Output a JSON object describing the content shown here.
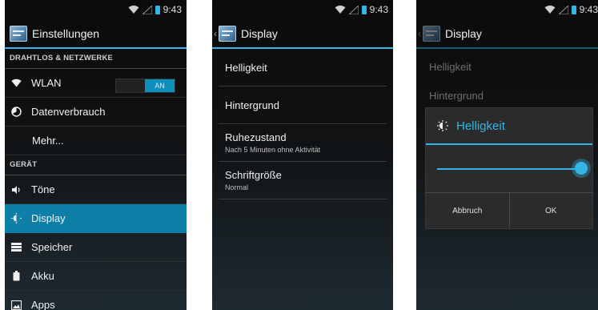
{
  "status": {
    "time": "9:43"
  },
  "screen1": {
    "title": "Einstellungen",
    "sections": [
      {
        "header": "DRAHTLOS & NETZWERKE",
        "items": [
          {
            "label": "WLAN",
            "icon": "wifi-icon",
            "toggle": "AN"
          },
          {
            "label": "Datenverbrauch",
            "icon": "data-usage-icon"
          },
          {
            "label": "Mehr..."
          }
        ]
      },
      {
        "header": "GERÄT",
        "items": [
          {
            "label": "Töne",
            "icon": "speaker-icon"
          },
          {
            "label": "Display",
            "icon": "brightness-icon",
            "selected": true
          },
          {
            "label": "Speicher",
            "icon": "storage-icon"
          },
          {
            "label": "Akku",
            "icon": "battery-icon"
          },
          {
            "label": "Apps",
            "icon": "apps-icon"
          }
        ]
      }
    ]
  },
  "screen2": {
    "title": "Display",
    "items": [
      {
        "title": "Helligkeit",
        "summary": ""
      },
      {
        "title": "Hintergrund",
        "summary": ""
      },
      {
        "title": "Ruhezustand",
        "summary": "Nach 5 Minuten ohne Aktivität"
      },
      {
        "title": "Schriftgröße",
        "summary": "Normal"
      }
    ]
  },
  "screen3": {
    "title": "Display",
    "background_items": [
      "Helligkeit",
      "Hintergrund"
    ],
    "dialog": {
      "title": "Helligkeit",
      "brightness_level": 1.0,
      "cancel_label": "Abbruch",
      "ok_label": "OK"
    }
  },
  "colors": {
    "accent": "#33b5e5",
    "selected_row": "#0e7fa6"
  }
}
